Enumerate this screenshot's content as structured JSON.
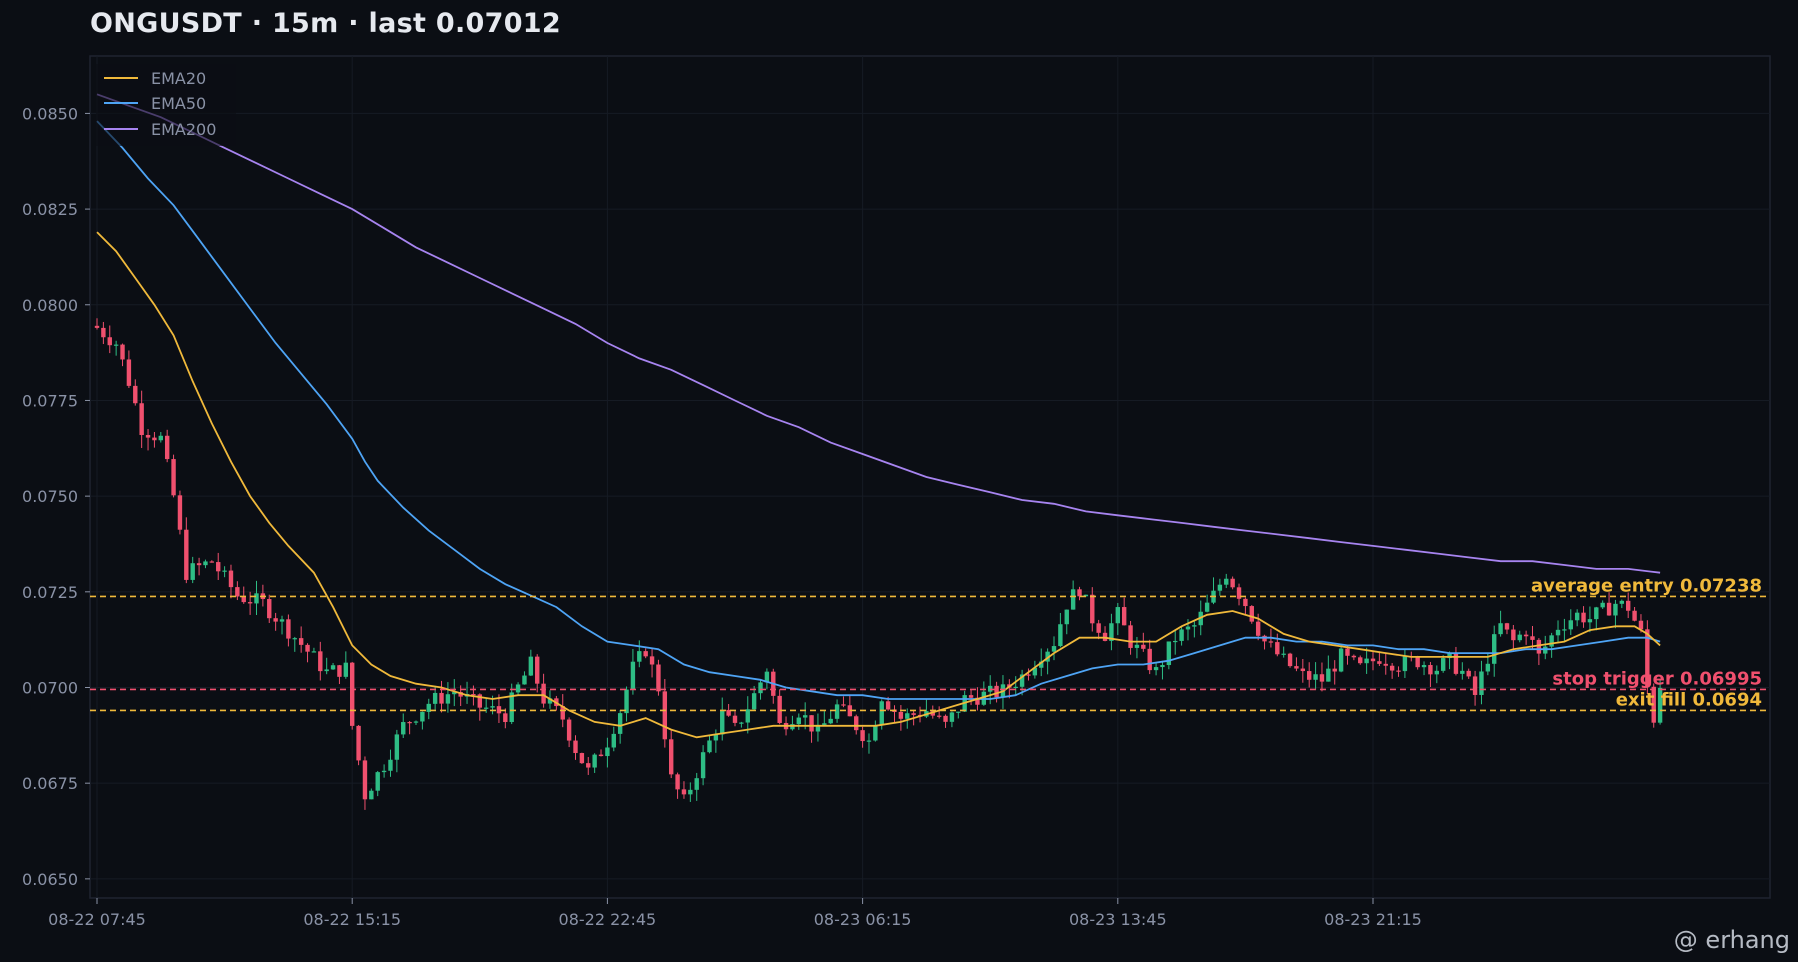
{
  "title": "ONGUSDT  ·  15m  ·  last 0.07012",
  "watermark": "@ erhang",
  "colors": {
    "background": "#0b0e14",
    "up": "#2ebd85",
    "down": "#f0506e",
    "ema20": "#f0b93b",
    "ema50": "#4ea4f5",
    "ema200": "#a784f0",
    "entry": "#f0b93b",
    "stop": "#f0506e",
    "exit": "#f0b93b"
  },
  "chart_data": {
    "type": "candlestick",
    "ylim": [
      0.0645,
      0.0865
    ],
    "xlim": [
      0,
      265
    ],
    "y_ticks": [
      "0.0650",
      "0.0675",
      "0.0700",
      "0.0725",
      "0.0750",
      "0.0775",
      "0.0800",
      "0.0825",
      "0.0850"
    ],
    "y_tick_values": [
      0.065,
      0.0675,
      0.07,
      0.0725,
      0.075,
      0.0775,
      0.08,
      0.0825,
      0.085
    ],
    "x_ticks": [
      "08-22 07:45",
      "08-22 15:15",
      "08-22 22:45",
      "08-23 06:15",
      "08-23 13:45",
      "08-23 21:15"
    ],
    "x_tick_index": [
      0,
      40,
      80,
      120,
      160,
      200
    ],
    "grid": true,
    "legend": {
      "placement": "top-left",
      "entries": [
        {
          "name": "EMA20",
          "color": "#f0b93b"
        },
        {
          "name": "EMA50",
          "color": "#4ea4f5"
        },
        {
          "name": "EMA200",
          "color": "#a784f0"
        }
      ]
    },
    "hlines": [
      {
        "label": "average entry 0.07238",
        "value": 0.07238,
        "color": "#f0b93b"
      },
      {
        "label": "stop trigger 0.06995",
        "value": 0.06995,
        "color": "#f0506e"
      },
      {
        "label": "exit fill 0.0694",
        "value": 0.0694,
        "color": "#f0b93b"
      }
    ],
    "close_anchors": [
      [
        0,
        0.0794
      ],
      [
        3,
        0.079
      ],
      [
        5,
        0.078
      ],
      [
        7,
        0.0768
      ],
      [
        10,
        0.0765
      ],
      [
        12,
        0.075
      ],
      [
        14,
        0.073
      ],
      [
        18,
        0.0733
      ],
      [
        22,
        0.0724
      ],
      [
        26,
        0.0722
      ],
      [
        30,
        0.0715
      ],
      [
        36,
        0.0704
      ],
      [
        39,
        0.0705
      ],
      [
        40,
        0.069
      ],
      [
        42,
        0.0672
      ],
      [
        45,
        0.068
      ],
      [
        48,
        0.069
      ],
      [
        52,
        0.0696
      ],
      [
        56,
        0.0699
      ],
      [
        60,
        0.0695
      ],
      [
        64,
        0.0693
      ],
      [
        66,
        0.07
      ],
      [
        68,
        0.0706
      ],
      [
        70,
        0.0697
      ],
      [
        73,
        0.0692
      ],
      [
        75,
        0.0684
      ],
      [
        77,
        0.0678
      ],
      [
        80,
        0.0686
      ],
      [
        82,
        0.0694
      ],
      [
        84,
        0.0705
      ],
      [
        86,
        0.071
      ],
      [
        88,
        0.07
      ],
      [
        89,
        0.0688
      ],
      [
        90,
        0.0676
      ],
      [
        92,
        0.067
      ],
      [
        95,
        0.0682
      ],
      [
        98,
        0.0693
      ],
      [
        100,
        0.0689
      ],
      [
        103,
        0.0698
      ],
      [
        105,
        0.0705
      ],
      [
        107,
        0.069
      ],
      [
        110,
        0.0694
      ],
      [
        113,
        0.0688
      ],
      [
        116,
        0.0695
      ],
      [
        119,
        0.069
      ],
      [
        121,
        0.0686
      ],
      [
        123,
        0.0698
      ],
      [
        126,
        0.0692
      ],
      [
        130,
        0.0694
      ],
      [
        133,
        0.069
      ],
      [
        136,
        0.0697
      ],
      [
        139,
        0.0698
      ],
      [
        142,
        0.0699
      ],
      [
        145,
        0.0703
      ],
      [
        148,
        0.0709
      ],
      [
        150,
        0.0712
      ],
      [
        152,
        0.0722
      ],
      [
        154,
        0.0726
      ],
      [
        156,
        0.0718
      ],
      [
        158,
        0.0714
      ],
      [
        160,
        0.0719
      ],
      [
        162,
        0.0712
      ],
      [
        164,
        0.0708
      ],
      [
        166,
        0.0704
      ],
      [
        169,
        0.0713
      ],
      [
        172,
        0.0716
      ],
      [
        175,
        0.0724
      ],
      [
        177,
        0.073
      ],
      [
        180,
        0.0722
      ],
      [
        183,
        0.0712
      ],
      [
        186,
        0.0707
      ],
      [
        189,
        0.0703
      ],
      [
        192,
        0.0702
      ],
      [
        195,
        0.0708
      ],
      [
        198,
        0.0705
      ],
      [
        201,
        0.0708
      ],
      [
        204,
        0.0706
      ],
      [
        207,
        0.0707
      ],
      [
        210,
        0.0705
      ],
      [
        212,
        0.0707
      ],
      [
        214,
        0.0704
      ],
      [
        216,
        0.0698
      ],
      [
        218,
        0.0708
      ],
      [
        220,
        0.0716
      ],
      [
        222,
        0.0712
      ],
      [
        224,
        0.0715
      ],
      [
        226,
        0.0708
      ],
      [
        229,
        0.0716
      ],
      [
        232,
        0.0719
      ],
      [
        234,
        0.0718
      ],
      [
        236,
        0.072
      ],
      [
        238,
        0.0722
      ],
      [
        240,
        0.0721
      ],
      [
        242,
        0.0714
      ],
      [
        243,
        0.07
      ],
      [
        244,
        0.0692
      ],
      [
        245,
        0.0701
      ]
    ],
    "ema20_points": [
      [
        0,
        0.0819
      ],
      [
        3,
        0.0814
      ],
      [
        6,
        0.0807
      ],
      [
        9,
        0.08
      ],
      [
        12,
        0.0792
      ],
      [
        15,
        0.078
      ],
      [
        18,
        0.0769
      ],
      [
        21,
        0.0759
      ],
      [
        24,
        0.075
      ],
      [
        27,
        0.0743
      ],
      [
        30,
        0.0737
      ],
      [
        34,
        0.073
      ],
      [
        37,
        0.0721
      ],
      [
        40,
        0.0711
      ],
      [
        43,
        0.0706
      ],
      [
        46,
        0.0703
      ],
      [
        50,
        0.0701
      ],
      [
        54,
        0.07
      ],
      [
        58,
        0.0698
      ],
      [
        62,
        0.0697
      ],
      [
        66,
        0.0698
      ],
      [
        70,
        0.0698
      ],
      [
        74,
        0.0694
      ],
      [
        78,
        0.0691
      ],
      [
        82,
        0.069
      ],
      [
        86,
        0.0692
      ],
      [
        90,
        0.0689
      ],
      [
        94,
        0.0687
      ],
      [
        98,
        0.0688
      ],
      [
        102,
        0.0689
      ],
      [
        106,
        0.069
      ],
      [
        110,
        0.069
      ],
      [
        114,
        0.069
      ],
      [
        118,
        0.069
      ],
      [
        122,
        0.069
      ],
      [
        126,
        0.0691
      ],
      [
        130,
        0.0693
      ],
      [
        134,
        0.0695
      ],
      [
        138,
        0.0697
      ],
      [
        142,
        0.0699
      ],
      [
        146,
        0.0704
      ],
      [
        150,
        0.0709
      ],
      [
        154,
        0.0713
      ],
      [
        158,
        0.0713
      ],
      [
        162,
        0.0712
      ],
      [
        166,
        0.0712
      ],
      [
        170,
        0.0716
      ],
      [
        174,
        0.0719
      ],
      [
        178,
        0.072
      ],
      [
        182,
        0.0718
      ],
      [
        186,
        0.0714
      ],
      [
        190,
        0.0712
      ],
      [
        194,
        0.0711
      ],
      [
        198,
        0.071
      ],
      [
        202,
        0.0709
      ],
      [
        206,
        0.0708
      ],
      [
        210,
        0.0708
      ],
      [
        214,
        0.0708
      ],
      [
        218,
        0.0708
      ],
      [
        222,
        0.071
      ],
      [
        226,
        0.0711
      ],
      [
        230,
        0.0712
      ],
      [
        234,
        0.0715
      ],
      [
        238,
        0.0716
      ],
      [
        241,
        0.0716
      ],
      [
        243,
        0.0714
      ],
      [
        245,
        0.0711
      ]
    ],
    "ema50_points": [
      [
        0,
        0.0848
      ],
      [
        4,
        0.0841
      ],
      [
        8,
        0.0833
      ],
      [
        12,
        0.0826
      ],
      [
        16,
        0.0817
      ],
      [
        20,
        0.0808
      ],
      [
        24,
        0.0799
      ],
      [
        28,
        0.079
      ],
      [
        32,
        0.0782
      ],
      [
        36,
        0.0774
      ],
      [
        40,
        0.0765
      ],
      [
        42,
        0.0759
      ],
      [
        44,
        0.0754
      ],
      [
        48,
        0.0747
      ],
      [
        52,
        0.0741
      ],
      [
        56,
        0.0736
      ],
      [
        60,
        0.0731
      ],
      [
        64,
        0.0727
      ],
      [
        68,
        0.0724
      ],
      [
        72,
        0.0721
      ],
      [
        76,
        0.0716
      ],
      [
        80,
        0.0712
      ],
      [
        84,
        0.0711
      ],
      [
        88,
        0.071
      ],
      [
        92,
        0.0706
      ],
      [
        96,
        0.0704
      ],
      [
        100,
        0.0703
      ],
      [
        104,
        0.0702
      ],
      [
        108,
        0.07
      ],
      [
        112,
        0.0699
      ],
      [
        116,
        0.0698
      ],
      [
        120,
        0.0698
      ],
      [
        124,
        0.0697
      ],
      [
        128,
        0.0697
      ],
      [
        132,
        0.0697
      ],
      [
        136,
        0.0697
      ],
      [
        140,
        0.0697
      ],
      [
        144,
        0.0698
      ],
      [
        148,
        0.0701
      ],
      [
        152,
        0.0703
      ],
      [
        156,
        0.0705
      ],
      [
        160,
        0.0706
      ],
      [
        164,
        0.0706
      ],
      [
        168,
        0.0707
      ],
      [
        172,
        0.0709
      ],
      [
        176,
        0.0711
      ],
      [
        180,
        0.0713
      ],
      [
        184,
        0.0713
      ],
      [
        188,
        0.0712
      ],
      [
        192,
        0.0712
      ],
      [
        196,
        0.0711
      ],
      [
        200,
        0.0711
      ],
      [
        204,
        0.071
      ],
      [
        208,
        0.071
      ],
      [
        212,
        0.0709
      ],
      [
        216,
        0.0709
      ],
      [
        220,
        0.0709
      ],
      [
        224,
        0.071
      ],
      [
        228,
        0.071
      ],
      [
        232,
        0.0711
      ],
      [
        236,
        0.0712
      ],
      [
        240,
        0.0713
      ],
      [
        243,
        0.0713
      ],
      [
        245,
        0.0712
      ]
    ],
    "ema200_points": [
      [
        0,
        0.0855
      ],
      [
        5,
        0.0852
      ],
      [
        10,
        0.0849
      ],
      [
        15,
        0.0845
      ],
      [
        20,
        0.0841
      ],
      [
        25,
        0.0837
      ],
      [
        30,
        0.0833
      ],
      [
        35,
        0.0829
      ],
      [
        40,
        0.0825
      ],
      [
        45,
        0.082
      ],
      [
        50,
        0.0815
      ],
      [
        55,
        0.0811
      ],
      [
        60,
        0.0807
      ],
      [
        65,
        0.0803
      ],
      [
        70,
        0.0799
      ],
      [
        75,
        0.0795
      ],
      [
        80,
        0.079
      ],
      [
        85,
        0.0786
      ],
      [
        90,
        0.0783
      ],
      [
        95,
        0.0779
      ],
      [
        100,
        0.0775
      ],
      [
        105,
        0.0771
      ],
      [
        110,
        0.0768
      ],
      [
        115,
        0.0764
      ],
      [
        120,
        0.0761
      ],
      [
        125,
        0.0758
      ],
      [
        130,
        0.0755
      ],
      [
        135,
        0.0753
      ],
      [
        140,
        0.0751
      ],
      [
        145,
        0.0749
      ],
      [
        150,
        0.0748
      ],
      [
        155,
        0.0746
      ],
      [
        160,
        0.0745
      ],
      [
        165,
        0.0744
      ],
      [
        170,
        0.0743
      ],
      [
        175,
        0.0742
      ],
      [
        180,
        0.0741
      ],
      [
        185,
        0.074
      ],
      [
        190,
        0.0739
      ],
      [
        195,
        0.0738
      ],
      [
        200,
        0.0737
      ],
      [
        205,
        0.0736
      ],
      [
        210,
        0.0735
      ],
      [
        215,
        0.0734
      ],
      [
        220,
        0.0733
      ],
      [
        225,
        0.0733
      ],
      [
        230,
        0.0732
      ],
      [
        235,
        0.0731
      ],
      [
        240,
        0.0731
      ],
      [
        245,
        0.073
      ]
    ]
  }
}
